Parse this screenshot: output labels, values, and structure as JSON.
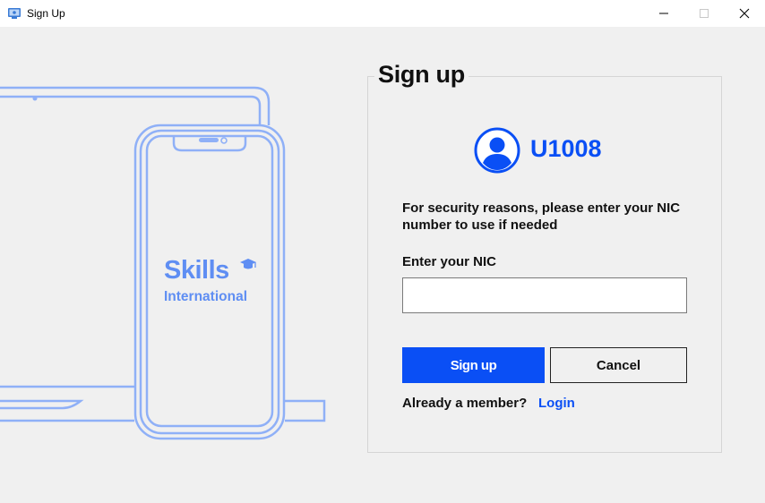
{
  "window": {
    "title": "Sign Up"
  },
  "logo": {
    "line1": "Skills",
    "line2": "International"
  },
  "form": {
    "heading": "Sign up",
    "user_id": "U1008",
    "security_message": "For security reasons, please enter your NIC number to use if needed",
    "nic_label": "Enter your NIC",
    "nic_value": "",
    "signup_label": "Sign up",
    "cancel_label": "Cancel",
    "member_prompt": "Already a member?",
    "login_label": "Login"
  },
  "colors": {
    "accent": "#0a4ff5",
    "illustration": "#8fb0f7",
    "background": "#f0f0f0"
  },
  "icons": [
    "app-window-icon",
    "minimize-icon",
    "maximize-icon",
    "close-icon",
    "user-avatar-icon",
    "graduation-cap-icon"
  ]
}
